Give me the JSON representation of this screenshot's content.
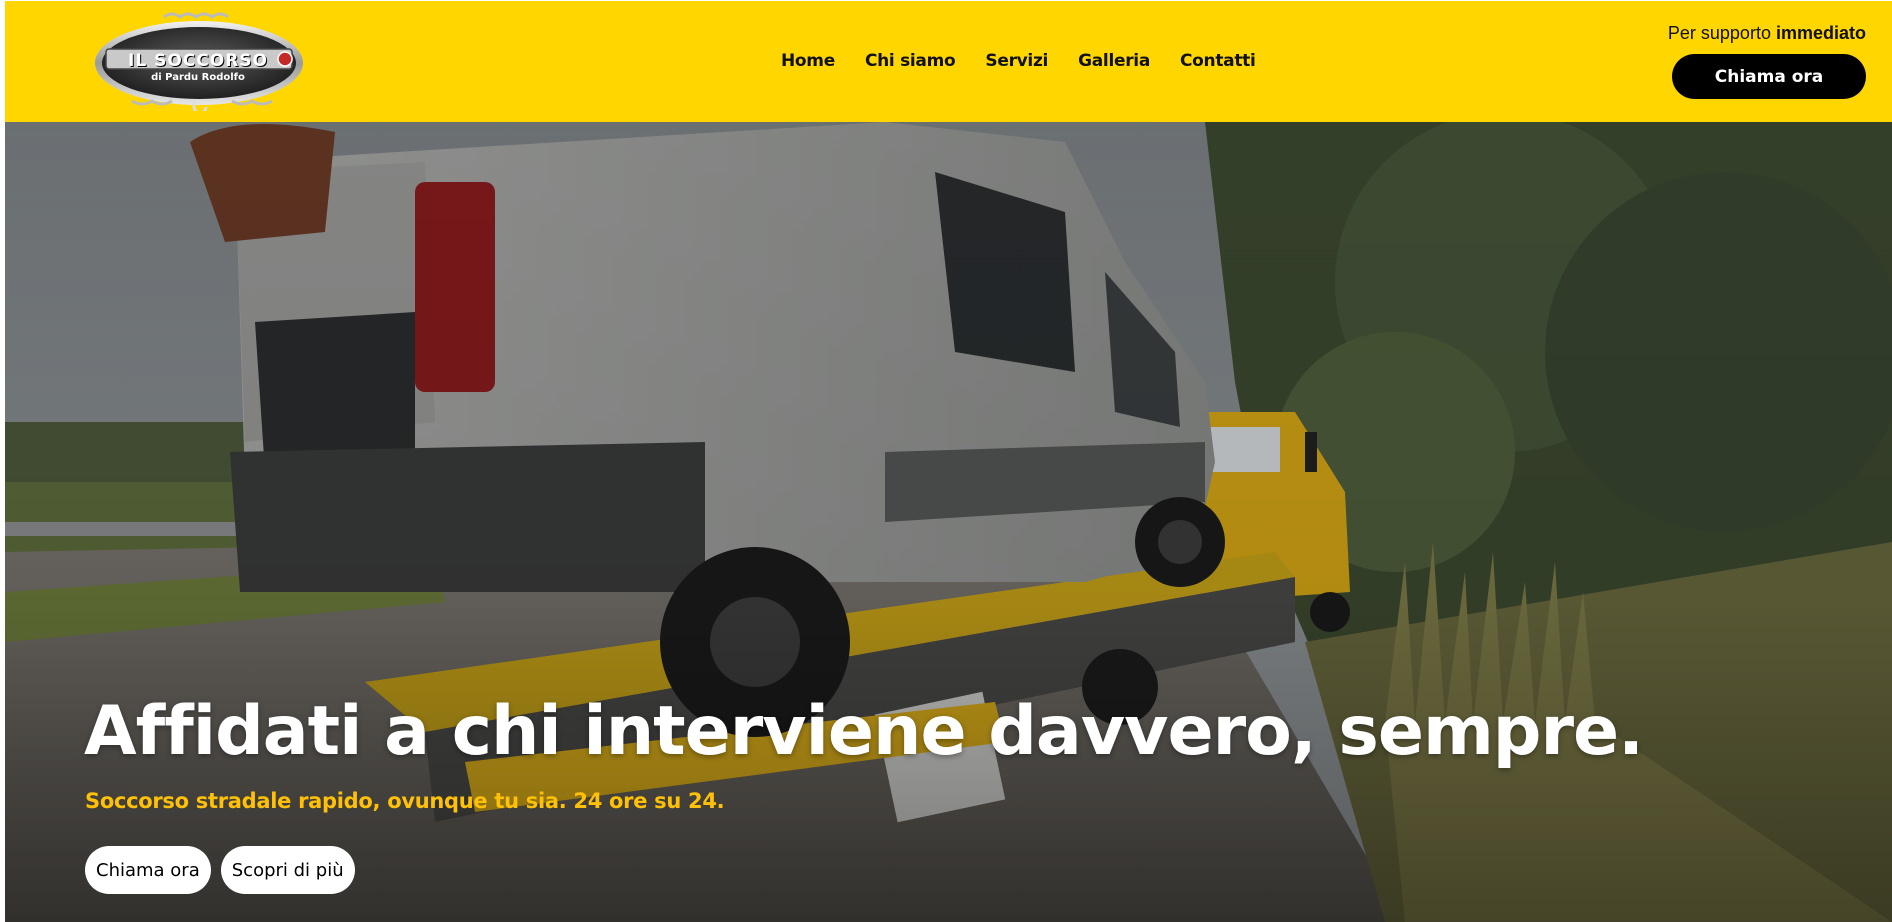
{
  "brand": {
    "logo_title": "IL SOCCORSO",
    "logo_subtitle": "di Pardu Rodolfo"
  },
  "nav": {
    "items": [
      {
        "label": "Home"
      },
      {
        "label": "Chi siamo"
      },
      {
        "label": "Servizi"
      },
      {
        "label": "Galleria"
      },
      {
        "label": "Contatti"
      }
    ]
  },
  "support": {
    "prefix": "Per supporto",
    "emphasis": "immediato",
    "cta_label": "Chiama ora"
  },
  "hero": {
    "title": "Affidati a chi interviene davvero, sempre.",
    "subtitle": "Soccorso stradale rapido, ovunque tu sia. 24 ore su 24.",
    "primary_button": "Chiama ora",
    "secondary_button": "Scopri di più"
  },
  "colors": {
    "header_bg": "#FFD600",
    "accent_yellow": "#FFC107",
    "cta_bg": "#000000"
  }
}
